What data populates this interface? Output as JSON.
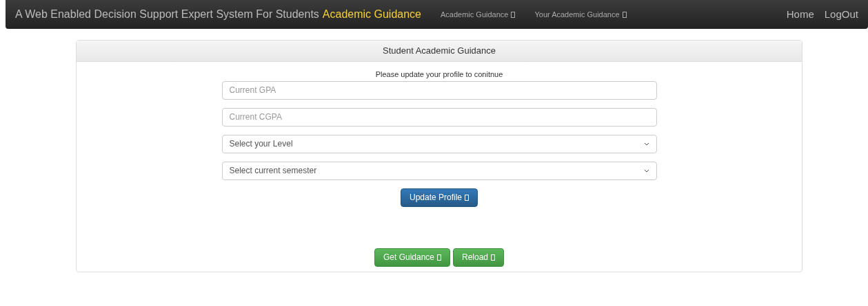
{
  "navbar": {
    "brand": "A Web Enabled Decision Support Expert System For Students",
    "brand_highlight": "Academic Guidance",
    "menu": [
      {
        "label": "Academic Guidance"
      },
      {
        "label": "Your Academic Guidance"
      }
    ],
    "right_links": [
      "Home",
      "LogOut"
    ]
  },
  "panel": {
    "heading": "Student Academic Guidance",
    "message": "Please update your profile to conitnue",
    "fields": [
      {
        "kind": "text",
        "placeholder": "Current GPA"
      },
      {
        "kind": "text",
        "placeholder": "Current CGPA"
      },
      {
        "kind": "select",
        "value": "Select your Level"
      },
      {
        "kind": "select",
        "value": "Select current semester"
      }
    ],
    "update_button": {
      "label": "Update Profile",
      "kind": "primary"
    },
    "actions": [
      {
        "label": "Get Guidance",
        "kind": "success"
      },
      {
        "label": "Reload",
        "kind": "success"
      }
    ]
  }
}
